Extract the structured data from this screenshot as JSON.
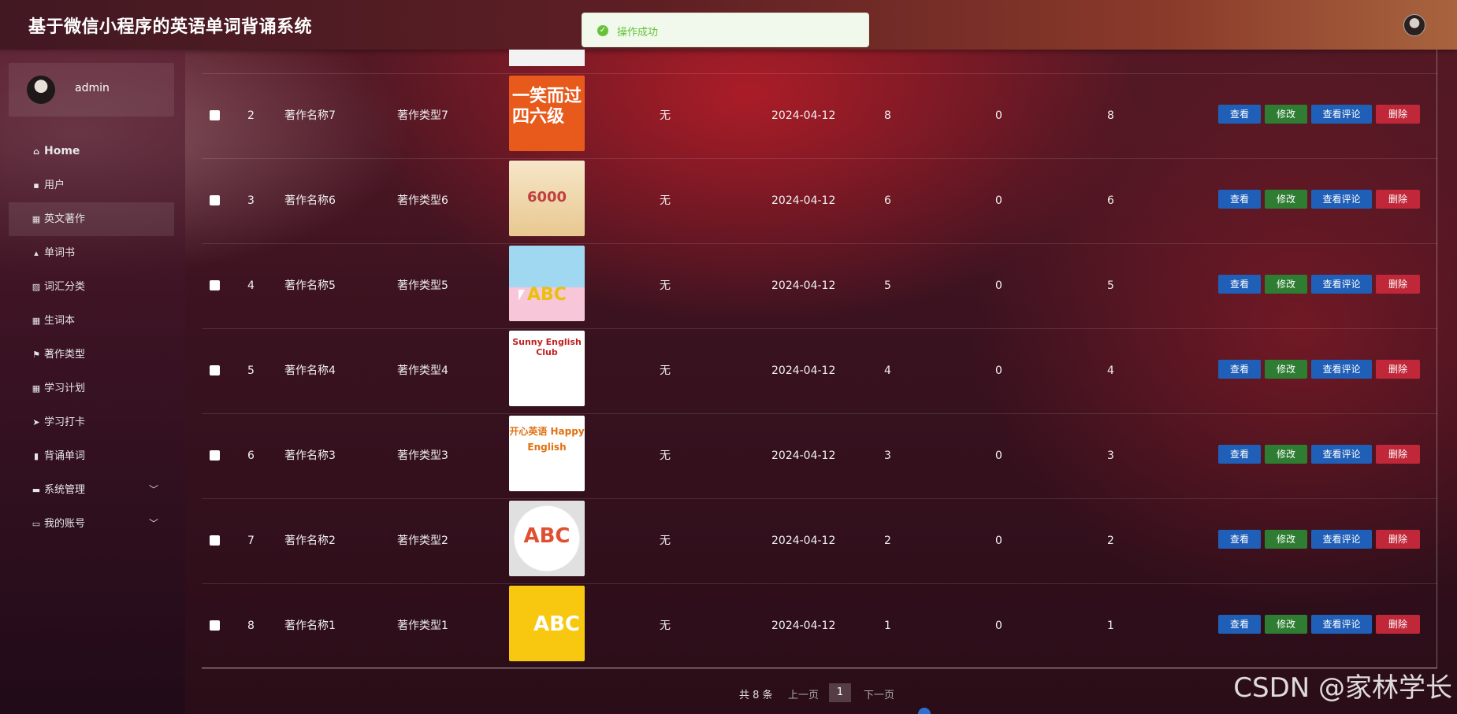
{
  "header": {
    "title": "基于微信小程序的英语单词背诵系统"
  },
  "toast": {
    "message": "操作成功",
    "color": "#67c23a"
  },
  "sidebar": {
    "username": "admin",
    "items": [
      {
        "label": "Home",
        "icon": "home-icon",
        "glyph": "⌂"
      },
      {
        "label": "用户",
        "icon": "user-icon",
        "glyph": "▪"
      },
      {
        "label": "英文著作",
        "icon": "grid-icon",
        "glyph": "▦"
      },
      {
        "label": "单词书",
        "icon": "thumbs-icon",
        "glyph": "▴"
      },
      {
        "label": "词汇分类",
        "icon": "chart-icon",
        "glyph": "▨"
      },
      {
        "label": "生词本",
        "icon": "grid-icon",
        "glyph": "▦"
      },
      {
        "label": "著作类型",
        "icon": "flag-icon",
        "glyph": "⚑"
      },
      {
        "label": "学习计划",
        "icon": "grid-icon",
        "glyph": "▦"
      },
      {
        "label": "学习打卡",
        "icon": "send-icon",
        "glyph": "➤"
      },
      {
        "label": "背诵单词",
        "icon": "bar-chart-icon",
        "glyph": "▮"
      },
      {
        "label": "系统管理",
        "icon": "briefcase-icon",
        "glyph": "▬"
      },
      {
        "label": "我的账号",
        "icon": "card-icon",
        "glyph": "▭"
      }
    ]
  },
  "table": {
    "rows": [
      {
        "index": "2",
        "name": "著作名称7",
        "type": "著作类型7",
        "note": "无",
        "date": "2024-04-12",
        "v1": "8",
        "v2": "0",
        "v3": "8",
        "thumb": "一笑而过 四六级"
      },
      {
        "index": "3",
        "name": "著作名称6",
        "type": "著作类型6",
        "note": "无",
        "date": "2024-04-12",
        "v1": "6",
        "v2": "0",
        "v3": "6",
        "thumb": "6000"
      },
      {
        "index": "4",
        "name": "著作名称5",
        "type": "著作类型5",
        "note": "无",
        "date": "2024-04-12",
        "v1": "5",
        "v2": "0",
        "v3": "5",
        "thumb": "ABC"
      },
      {
        "index": "5",
        "name": "著作名称4",
        "type": "著作类型4",
        "note": "无",
        "date": "2024-04-12",
        "v1": "4",
        "v2": "0",
        "v3": "4",
        "thumb": "Sunny English Club"
      },
      {
        "index": "6",
        "name": "著作名称3",
        "type": "著作类型3",
        "note": "无",
        "date": "2024-04-12",
        "v1": "3",
        "v2": "0",
        "v3": "3",
        "thumb": "开心英语 Happy English"
      },
      {
        "index": "7",
        "name": "著作名称2",
        "type": "著作类型2",
        "note": "无",
        "date": "2024-04-12",
        "v1": "2",
        "v2": "0",
        "v3": "2",
        "thumb": "ABC"
      },
      {
        "index": "8",
        "name": "著作名称1",
        "type": "著作类型1",
        "note": "无",
        "date": "2024-04-12",
        "v1": "1",
        "v2": "0",
        "v3": "1",
        "thumb": "ABC"
      }
    ],
    "actions": {
      "view": "查看",
      "edit": "修改",
      "comments": "查看评论",
      "delete": "删除"
    }
  },
  "pagination": {
    "total": "共 8 条",
    "prev": "上一页",
    "page": "1",
    "next": "下一页"
  },
  "watermark": "CSDN @家林学长",
  "colors": {
    "view": "#1f5fb8",
    "edit": "#2e7d32",
    "delete": "#c0283a"
  }
}
